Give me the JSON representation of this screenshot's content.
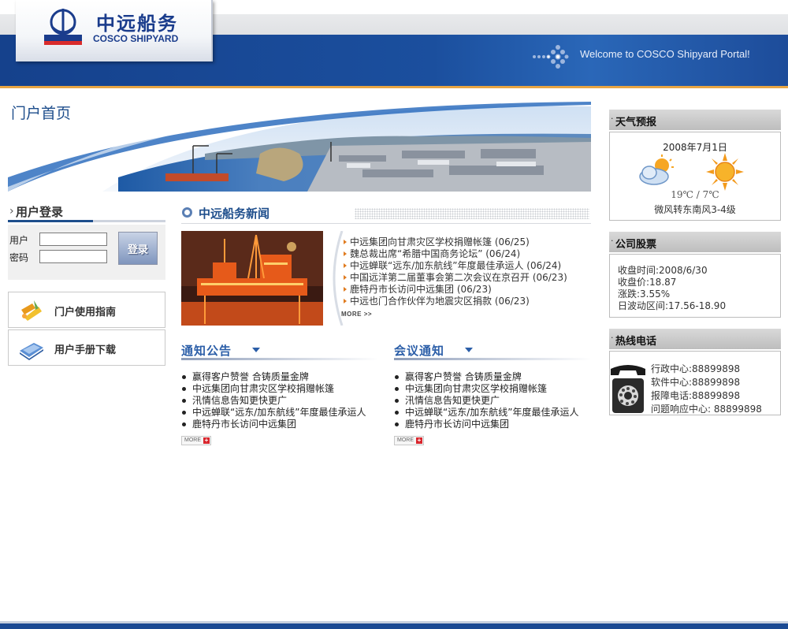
{
  "header": {
    "logo_cn": "中远船务",
    "logo_en": "COSCO SHIPYARD",
    "welcome": "Welcome to COSCO Shipyard Portal!"
  },
  "banner": {
    "title": "门户首页"
  },
  "login": {
    "title": "用户登录",
    "user_label": "用户",
    "password_label": "密码",
    "user_value": "",
    "password_value": "",
    "button": "登录"
  },
  "links": [
    {
      "label": "门户使用指南"
    },
    {
      "label": "用户手册下载"
    }
  ],
  "news": {
    "title": "中远船务新闻",
    "items": [
      "中远集团向甘肃灾区学校捐赠帐篷 (06/25)",
      "魏总裁出席“希腊中国商务论坛” (06/24)",
      "中远蝉联“远东/加东航线”年度最佳承运人 (06/24)",
      "中国远洋第二届董事会第二次会议在京召开 (06/23)",
      "鹿特丹市长访问中远集团 (06/23)",
      "中远也门合作伙伴为地震灾区捐款 (06/23)"
    ],
    "more": "MORE >>"
  },
  "notice": {
    "title": "通知公告",
    "items": [
      "赢得客户赞誉 合铸质量金牌",
      "中远集团向甘肃灾区学校捐赠帐篷",
      "汛情信息告知更快更广",
      "中远蝉联“远东/加东航线”年度最佳承运人",
      "鹿特丹市长访问中远集团"
    ],
    "more": "MORE"
  },
  "meeting": {
    "title": "会议通知",
    "items": [
      "赢得客户赞誉 合铸质量金牌",
      "中远集团向甘肃灾区学校捐赠帐篷",
      "汛情信息告知更快更广",
      "中远蝉联“远东/加东航线”年度最佳承运人",
      "鹿特丹市长访问中远集团"
    ],
    "more": "MORE"
  },
  "weather": {
    "title": "天气预报",
    "date": "2008年7月1日",
    "temp": "19℃ / 7℃",
    "desc": "微风转东南风3-4级",
    "icons": [
      "cloud-sun-icon",
      "sun-icon"
    ]
  },
  "stock": {
    "title": "公司股票",
    "lines": [
      "收盘时间:2008/6/30",
      "收盘价:18.87",
      "涨跌:3.55%",
      "日波动区间:17.56-18.90"
    ]
  },
  "hotline": {
    "title": "热线电话",
    "lines": [
      "行政中心:88899898",
      "软件中心:88899898",
      "报障电话:88899898",
      "问题响应中心: 88899898"
    ]
  },
  "colors": {
    "brand_blue": "#1b4f9e",
    "accent_orange": "#e8a544",
    "heading_blue": "#1e4e8c"
  }
}
